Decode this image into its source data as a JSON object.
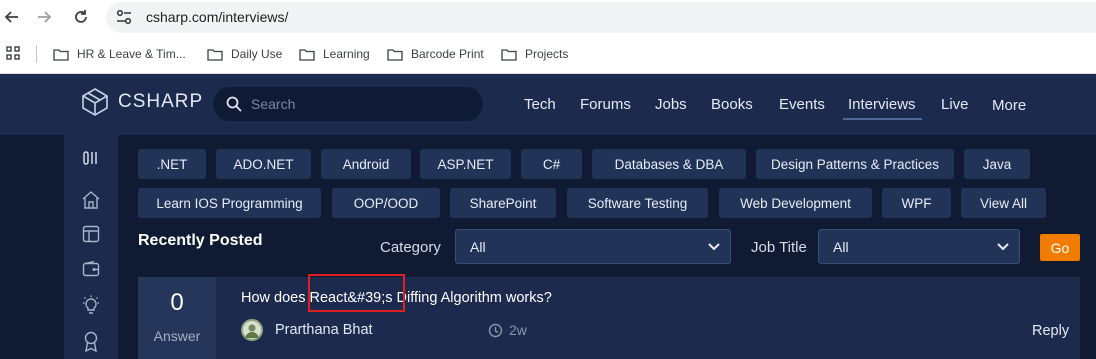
{
  "browser": {
    "url": "csharp.com/interviews/",
    "bookmarks": [
      {
        "label": "HR & Leave & Tim..."
      },
      {
        "label": "Daily Use"
      },
      {
        "label": "Learning"
      },
      {
        "label": "Barcode Print"
      },
      {
        "label": "Projects"
      }
    ]
  },
  "site": {
    "logo_text": "CSHARP",
    "search_placeholder": "Search",
    "nav": [
      {
        "label": "Tech"
      },
      {
        "label": "Forums"
      },
      {
        "label": "Jobs"
      },
      {
        "label": "Books"
      },
      {
        "label": "Events"
      },
      {
        "label": "Interviews",
        "active": true
      },
      {
        "label": "Live"
      },
      {
        "label": "More"
      }
    ]
  },
  "rail": {
    "icons": [
      "sidebar-toggle-icon",
      "home-icon",
      "layout-icon",
      "wallet-icon",
      "lightbulb-icon",
      "award-icon"
    ]
  },
  "categories": [
    ".NET",
    "ADO.NET",
    "Android",
    "ASP.NET",
    "C#",
    "Databases & DBA",
    "Design Patterns & Practices",
    "Java",
    "Learn IOS Programming",
    "OOP/OOD",
    "SharePoint",
    "Software Testing",
    "Web Development",
    "WPF",
    "View All"
  ],
  "filters": {
    "section_title": "Recently Posted",
    "category_label": "Category",
    "category_value": "All",
    "job_title_label": "Job Title",
    "job_title_value": "All",
    "go_label": "Go"
  },
  "post": {
    "answer_count": "0",
    "answer_label": "Answer",
    "title": "How does React&#39;s Diffing Algorithm works?",
    "author": "Prarthana Bhat",
    "time": "2w",
    "reply_label": "Reply"
  },
  "colors": {
    "header_bg": "#1c2a4e",
    "page_bg": "#101a33",
    "chip_bg": "#223358",
    "go_button": "#f27c00",
    "highlight_border": "#e02020"
  }
}
